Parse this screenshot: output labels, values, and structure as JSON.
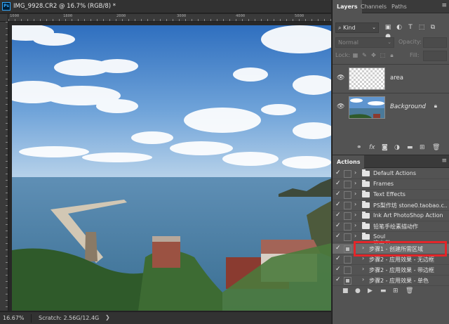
{
  "document": {
    "app_icon": "Ps",
    "title": "IMG_9928.CR2 @ 16.7% (RGB/8) *"
  },
  "rulers": {
    "top_ticks": [
      "1000",
      "1800",
      "2000",
      "3000",
      "4000",
      "5000"
    ],
    "left_ticks": [
      "0",
      "200",
      "400",
      "600",
      "800",
      "1000",
      "1200",
      "1400",
      "1600",
      "1800",
      "2000",
      "2200",
      "2400",
      "2600",
      "2800",
      "3000",
      "3200",
      "3400"
    ]
  },
  "status_bar": {
    "zoom": "16.67%",
    "scratch": "Scratch: 2.56G/12.4G"
  },
  "layers_panel": {
    "tabs": [
      "Layers",
      "Channels",
      "Paths"
    ],
    "active_tab": "Layers",
    "filter": "Kind",
    "blend_mode": "Normal",
    "opacity_label": "Opacity:",
    "lock_label": "Lock:",
    "fill_label": "Fill:",
    "layers": [
      {
        "name": "area",
        "visible": true,
        "thumbnail": "transparent-checker"
      },
      {
        "name": "Background",
        "visible": true,
        "thumbnail": "photo",
        "locked": true
      }
    ],
    "footer_icons": [
      "link-icon",
      "fx-icon",
      "mask-icon",
      "adjustment-icon",
      "group-icon",
      "new-layer-icon",
      "trash-icon"
    ]
  },
  "actions_panel": {
    "title": "Actions",
    "items": [
      {
        "label": "Default Actions",
        "checked": true,
        "dialog": false,
        "type": "set"
      },
      {
        "label": "Frames",
        "checked": true,
        "dialog": false,
        "type": "set"
      },
      {
        "label": "Text Effects",
        "checked": true,
        "dialog": false,
        "type": "set"
      },
      {
        "label": "PS梨作坊 stone0.taobao.c...",
        "checked": true,
        "dialog": false,
        "type": "set"
      },
      {
        "label": "Ink Art PhotoShop Action",
        "checked": true,
        "dialog": false,
        "type": "set"
      },
      {
        "label": "铅笔手绘素描动作",
        "checked": true,
        "dialog": false,
        "type": "set"
      },
      {
        "label": "Soul",
        "checked": true,
        "dialog": false,
        "type": "set"
      },
      {
        "label": "这本书",
        "checked": true,
        "dialog": false,
        "type": "set"
      },
      {
        "label": "步骤1 - 创建所需区域",
        "checked": true,
        "dialog": true,
        "type": "action",
        "selected": true
      },
      {
        "label": "步骤2 - 应用效果 - 无边框",
        "checked": true,
        "dialog": false,
        "type": "action"
      },
      {
        "label": "步骤2 - 应用效果 - 带边框",
        "checked": true,
        "dialog": false,
        "type": "action"
      },
      {
        "label": "步骤2 - 应用效果 - 单色",
        "checked": true,
        "dialog": true,
        "type": "action"
      }
    ],
    "footer_icons": [
      "stop-icon",
      "record-icon",
      "play-icon",
      "new-set-icon",
      "new-action-icon",
      "trash-icon"
    ]
  },
  "colors": {
    "highlight": "#e3262a",
    "panel_bg": "#535353",
    "tab_bar_bg": "#3a3a3a"
  }
}
